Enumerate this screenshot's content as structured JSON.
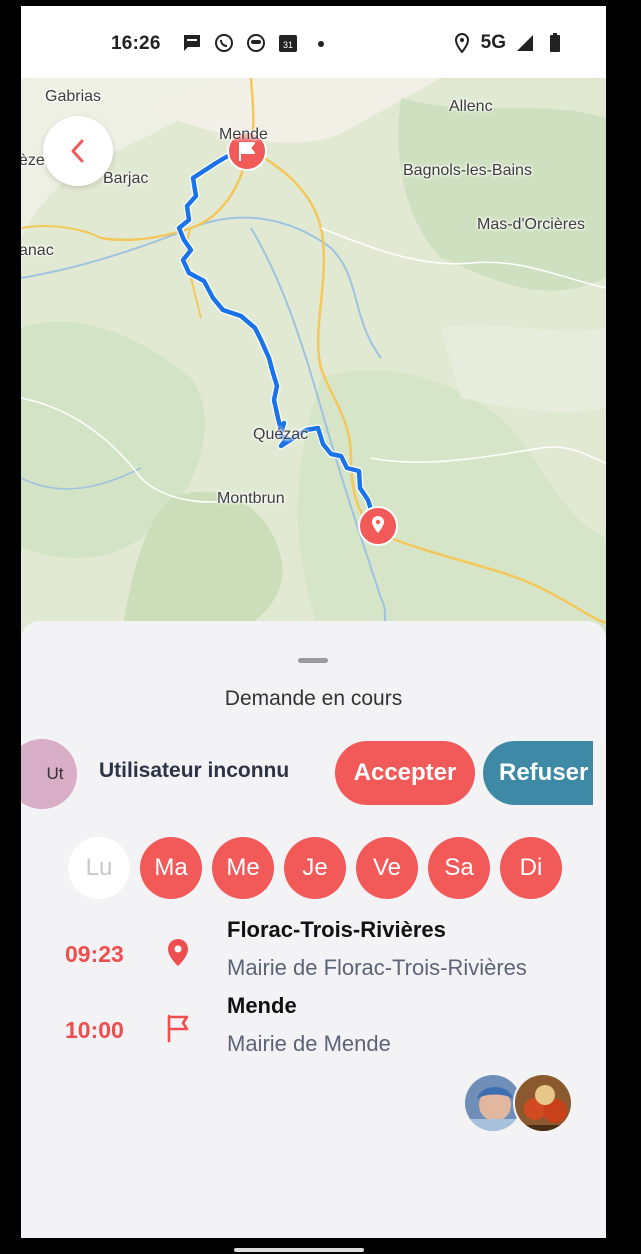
{
  "status_bar": {
    "time": "16:26",
    "network": "5G",
    "icons": [
      "message-icon",
      "whatsapp-icon",
      "face-icon",
      "calendar-icon",
      "location-icon",
      "signal-icon",
      "battery-icon"
    ],
    "calendar_day": "31"
  },
  "map": {
    "labels": {
      "gabrias": "Gabrias",
      "allenc": "Allenc",
      "mende": "Mende",
      "barjac": "Barjac",
      "bagnols": "Bagnols-les-Bains",
      "mas_dorcieres": "Mas-d'Orcières",
      "eze": "èze",
      "anac": "anac",
      "quezac": "Quézac",
      "montbrun": "Montbrun"
    },
    "route_color": "#1a73e8",
    "marker_color": "#f25a5a"
  },
  "sheet": {
    "title": "Demande en cours",
    "user": {
      "initials": "Ut",
      "name": "Utilisateur inconnu"
    },
    "accept_label": "Accepter",
    "refuse_label": "Refuser",
    "days": [
      {
        "label": "Lu",
        "active": false
      },
      {
        "label": "Ma",
        "active": true
      },
      {
        "label": "Me",
        "active": true
      },
      {
        "label": "Je",
        "active": true
      },
      {
        "label": "Ve",
        "active": true
      },
      {
        "label": "Sa",
        "active": true
      },
      {
        "label": "Di",
        "active": true
      }
    ],
    "departure": {
      "time": "09:23",
      "city": "Florac-Trois-Rivières",
      "place": "Mairie de Florac-Trois-Rivières"
    },
    "arrival": {
      "time": "10:00",
      "city": "Mende",
      "place": "Mairie de Mende"
    }
  },
  "colors": {
    "accent": "#f25a5a",
    "secondary": "#3e8aa6",
    "text_muted": "#5d6478"
  }
}
